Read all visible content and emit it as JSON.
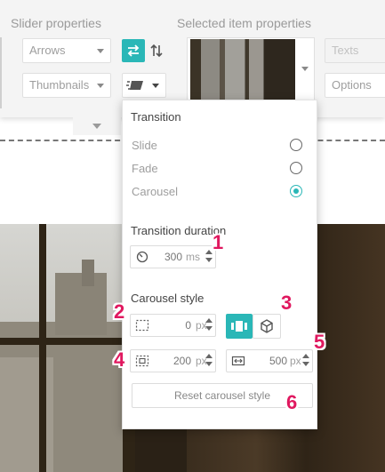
{
  "toolbar": {
    "slider_properties_label": "Slider properties",
    "selected_item_properties_label": "Selected item properties",
    "arrows_select": "Arrows",
    "thumbnails_select": "Thumbnails",
    "texts_select": "Texts",
    "options_select": "Options"
  },
  "transition_popover": {
    "title": "Transition",
    "options": [
      {
        "label": "Slide",
        "selected": false
      },
      {
        "label": "Fade",
        "selected": false
      },
      {
        "label": "Carousel",
        "selected": true
      }
    ],
    "duration_label": "Transition duration",
    "duration_value": "300",
    "duration_unit": "ms",
    "carousel_style_label": "Carousel style",
    "gap_value": "0",
    "gap_unit": "px",
    "padding_value": "200",
    "padding_unit": "px",
    "width_value": "500",
    "width_unit": "px",
    "reset_label": "Reset carousel style"
  },
  "markers": [
    "1",
    "2",
    "3",
    "4",
    "5",
    "6"
  ],
  "colors": {
    "accent": "#2ab7b7",
    "marker": "#e0185f"
  }
}
